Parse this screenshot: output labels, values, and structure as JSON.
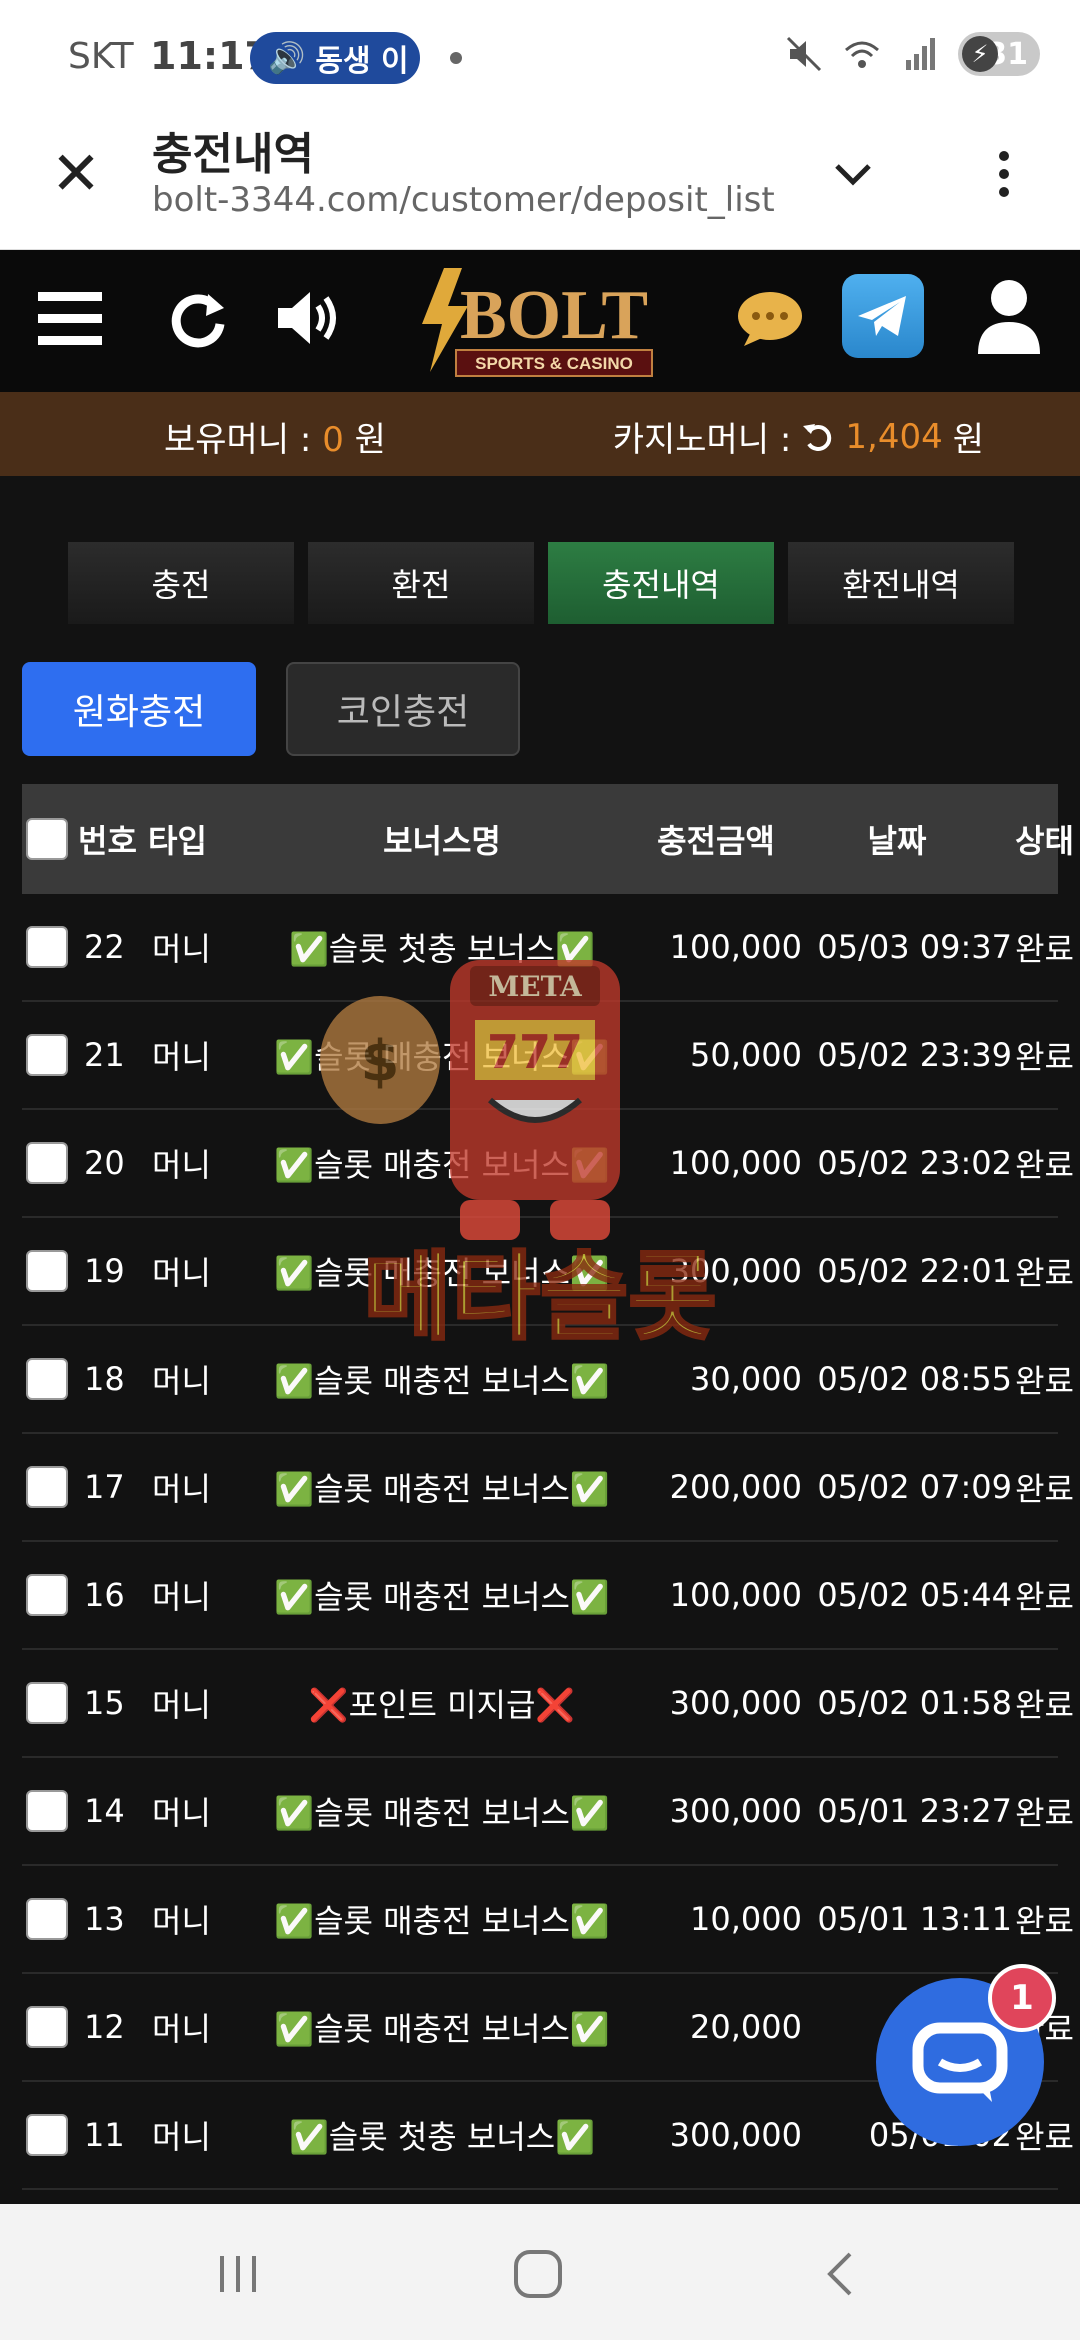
{
  "status_bar": {
    "carrier": "SKT",
    "time": "11:17",
    "sound_pill": "동생 이",
    "battery": "31"
  },
  "browser": {
    "title": "충전내역",
    "url": "bolt-3344.com/customer/deposit_list"
  },
  "site": {
    "logo_text": "BOLT",
    "logo_subtext": "SPORTS & CASINO"
  },
  "money": {
    "holding_label": "보유머니 :",
    "holding_value": "0",
    "holding_unit": "원",
    "casino_label": "카지노머니 :",
    "casino_value": "1,404",
    "casino_unit": "원"
  },
  "tabs": [
    {
      "label": "충전",
      "active": false
    },
    {
      "label": "환전",
      "active": false
    },
    {
      "label": "충전내역",
      "active": true
    },
    {
      "label": "환전내역",
      "active": false
    }
  ],
  "sub_tabs": {
    "won": "원화충전",
    "coin": "코인충전"
  },
  "table": {
    "headers": {
      "number_type": "번호 타입",
      "bonus": "보너스명",
      "amount": "충전금액",
      "date": "날짜",
      "status": "상태"
    },
    "rows": [
      {
        "num": "22",
        "type": "머니",
        "bonus": "✅슬롯 첫충 보너스✅",
        "amount": "100,000",
        "date": "05/03 09:37",
        "status": "완료"
      },
      {
        "num": "21",
        "type": "머니",
        "bonus": "✅슬롯 매충전 보너스✅",
        "amount": "50,000",
        "date": "05/02 23:39",
        "status": "완료"
      },
      {
        "num": "20",
        "type": "머니",
        "bonus": "✅슬롯 매충전 보너스✅",
        "amount": "100,000",
        "date": "05/02 23:02",
        "status": "완료"
      },
      {
        "num": "19",
        "type": "머니",
        "bonus": "✅슬롯 매충전 보너스✅",
        "amount": "300,000",
        "date": "05/02 22:01",
        "status": "완료"
      },
      {
        "num": "18",
        "type": "머니",
        "bonus": "✅슬롯 매충전 보너스✅",
        "amount": "30,000",
        "date": "05/02 08:55",
        "status": "완료"
      },
      {
        "num": "17",
        "type": "머니",
        "bonus": "✅슬롯 매충전 보너스✅",
        "amount": "200,000",
        "date": "05/02 07:09",
        "status": "완료"
      },
      {
        "num": "16",
        "type": "머니",
        "bonus": "✅슬롯 매충전 보너스✅",
        "amount": "100,000",
        "date": "05/02 05:44",
        "status": "완료"
      },
      {
        "num": "15",
        "type": "머니",
        "bonus": "❌포인트 미지급❌",
        "amount": "300,000",
        "date": "05/02 01:58",
        "status": "완료"
      },
      {
        "num": "14",
        "type": "머니",
        "bonus": "✅슬롯 매충전 보너스✅",
        "amount": "300,000",
        "date": "05/01 23:27",
        "status": "완료"
      },
      {
        "num": "13",
        "type": "머니",
        "bonus": "✅슬롯 매충전 보너스✅",
        "amount": "10,000",
        "date": "05/01 13:11",
        "status": "완료"
      },
      {
        "num": "12",
        "type": "머니",
        "bonus": "✅슬롯 매충전 보너스✅",
        "amount": "20,000",
        "date": "05/01",
        "status": "완료"
      },
      {
        "num": "11",
        "type": "머니",
        "bonus": "✅슬롯 첫충 보너스✅",
        "amount": "300,000",
        "date": "05/01 02",
        "status": "완료"
      }
    ]
  },
  "watermark": {
    "sign_text": "META",
    "slot_text": "777",
    "caption": "메타슬롯"
  },
  "chat_badge": "1",
  "colors": {
    "accent_orange": "#e98d2b",
    "active_tab": "#2d7d43",
    "won_button": "#2e6ef0",
    "money_bar": "#4a2e18"
  }
}
